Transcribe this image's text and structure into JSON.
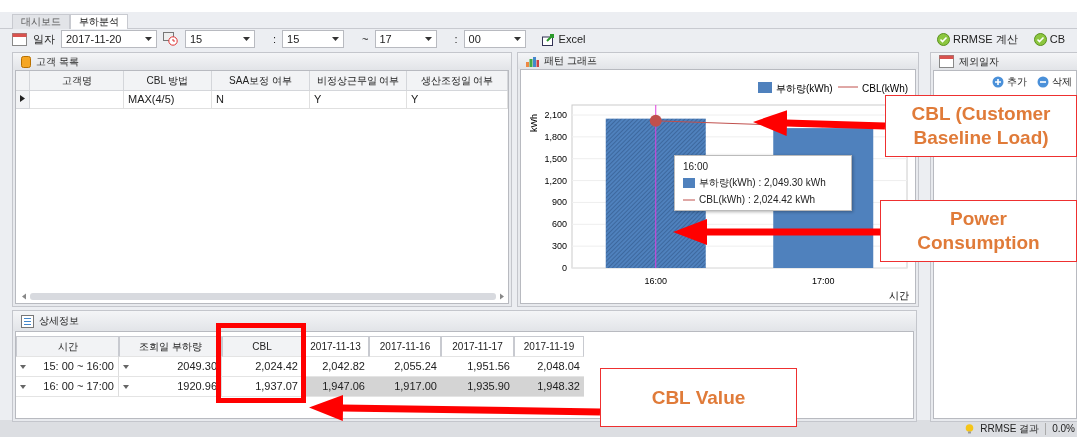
{
  "tabs": [
    {
      "label": "대시보드",
      "selected": false
    },
    {
      "label": "부하분석",
      "selected": true
    }
  ],
  "toolbar": {
    "date_label": "일자",
    "date": "2017-11-20",
    "time_fields": [
      {
        "value": "15"
      },
      {
        "separator": ":",
        "value": "15"
      },
      {
        "separator": "~",
        "value": "17"
      },
      {
        "separator": ":",
        "value": "00"
      }
    ],
    "excel_button": "Excel",
    "actions": [
      "RRMSE 계산",
      "CB"
    ]
  },
  "customer_panel": {
    "title": "고객 목록",
    "columns": [
      "고객명",
      "CBL 방법",
      "SAA보정 여부",
      "비정상근무일 여부",
      "생산조정일 여부"
    ],
    "rows": [
      {
        "selected": true,
        "cells": [
          "",
          "MAX(4/5)",
          "N",
          "Y",
          "Y"
        ]
      }
    ]
  },
  "chart_panel": {
    "title": "패턴 그래프",
    "category_selected": [
      true,
      false
    ],
    "chart_data": {
      "type": "bar",
      "xlabel": "시간",
      "ylabel": "kWh",
      "categories": [
        "16:00",
        "17:00"
      ],
      "series": [
        {
          "name": "부하량(kWh)",
          "type": "bar",
          "color": "#4f81bd",
          "values": [
            2050,
            1920
          ]
        },
        {
          "name": "CBL(kWh)",
          "type": "line",
          "color": "#c0504d",
          "values": [
            2020,
            1940
          ]
        }
      ],
      "ylim": [
        0,
        2100
      ],
      "grid": true,
      "legend": true,
      "ref_lines": [
        {
          "axis": "x",
          "value": "16:00",
          "color": "#e040e0"
        }
      ],
      "yticks": [
        0,
        300,
        600,
        900,
        {
          "value": 1200,
          "label": "1,200"
        },
        {
          "value": 1500,
          "label": "1,500"
        },
        {
          "value": 1800,
          "label": "1,800"
        },
        {
          "value": 2100,
          "label": "2,100"
        }
      ]
    },
    "tooltip": {
      "title": "16:00",
      "entries": [
        "부하량(kWh) : 2,049.30 kWh",
        "CBL(kWh) : 2,024.42 kWh"
      ]
    }
  },
  "excluded_panel": {
    "title": "제외일자",
    "buttons": [
      "추가",
      "삭제"
    ]
  },
  "detail_panel": {
    "title": "상세정보",
    "columns": [
      "시간",
      "조회일 부하량",
      "CBL",
      "2017-11-13",
      "2017-11-16",
      "2017-11-17",
      "2017-11-19"
    ],
    "rows": [
      {
        "selected": false,
        "cells": [
          "15: 00 ~ 16:00",
          "2049.30",
          "2,024.42",
          "2,042.82",
          "2,055.24",
          "1,951.56",
          "2,048.04"
        ]
      },
      {
        "selected": true,
        "cells": [
          "16: 00 ~ 17:00",
          "1920.96",
          "1,937.07",
          "1,947.06",
          "1,917.00",
          "1,935.90",
          "1,948.32"
        ]
      }
    ]
  },
  "status_bar": {
    "label": "RRMSE 결과",
    "value": "0.0%"
  },
  "annotations": [
    {
      "text": "CBL (Customer Baseline Load)"
    },
    {
      "text": "Power Consumption"
    },
    {
      "text": "CBL Value"
    }
  ]
}
